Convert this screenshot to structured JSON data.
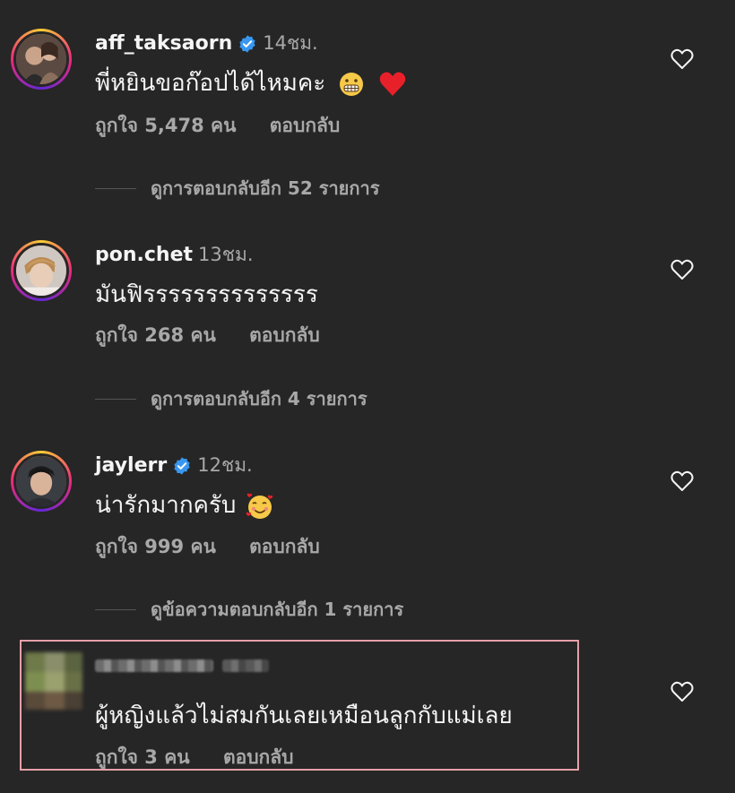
{
  "comments": [
    {
      "username": "aff_taksaorn",
      "verified": true,
      "time": "14ชม.",
      "text": "พี่หยินขอก๊อปได้ไหมคะ",
      "emojis": [
        "grimacing-face",
        "red-heart"
      ],
      "likes": "ถูกใจ 5,478 คน",
      "reply_label": "ตอบกลับ",
      "view_replies": "ดูการตอบกลับอีก 52 รายการ"
    },
    {
      "username": "pon.chet",
      "verified": false,
      "time": "13ชม.",
      "text": "มันฟิรรรรรรรรรรรรรร",
      "emojis": [],
      "likes": "ถูกใจ 268 คน",
      "reply_label": "ตอบกลับ",
      "view_replies": "ดูการตอบกลับอีก 4 รายการ"
    },
    {
      "username": "jaylerr",
      "verified": true,
      "time": "12ชม.",
      "text": "น่ารักมากครับ",
      "emojis": [
        "smiling-face-with-hearts"
      ],
      "likes": "ถูกใจ 999 คน",
      "reply_label": "ตอบกลับ",
      "view_replies": "ดูข้อความตอบกลับอีก 1 รายการ"
    },
    {
      "username": "",
      "username_blurred": true,
      "verified": false,
      "time": "",
      "text": "ผู้หญิงแล้วไม่สมกันเลยเหมือนลูกกับแม่เลย",
      "emojis": [],
      "likes": "ถูกใจ 3 คน",
      "reply_label": "ตอบกลับ",
      "highlighted": true,
      "highlight_color": "#e6a0a8"
    }
  ],
  "colors": {
    "background": "#262626",
    "primary_text": "#f5f5f5",
    "secondary_text": "#a8a8a8",
    "verified_blue": "#3897f0",
    "heart_red": "#ed4956"
  },
  "icons": {
    "like": "heart-outline-icon",
    "verified": "verified-badge-icon"
  }
}
